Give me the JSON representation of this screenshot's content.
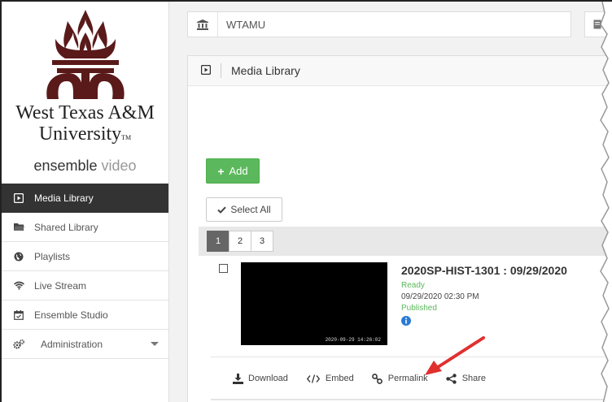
{
  "sidebar": {
    "university_line1": "West Texas A&M",
    "university_line2": "University",
    "tm": "TM",
    "product_bold": "ensemble",
    "product_light": "video",
    "items": [
      {
        "label": "Media Library",
        "icon": "media-icon",
        "active": true
      },
      {
        "label": "Shared Library",
        "icon": "folder-icon",
        "active": false
      },
      {
        "label": "Playlists",
        "icon": "globe-icon",
        "active": false
      },
      {
        "label": "Live Stream",
        "icon": "wifi-icon",
        "active": false
      },
      {
        "label": "Ensemble Studio",
        "icon": "calendar-icon",
        "active": false
      },
      {
        "label": "Administration",
        "icon": "gears-icon",
        "active": false
      }
    ]
  },
  "org": {
    "name": "WTAMU",
    "icon": "bank-icon"
  },
  "panel": {
    "title": "Media Library"
  },
  "toolbar": {
    "add_label": "Add",
    "select_all_label": "Select All"
  },
  "pagination": {
    "pages": [
      "1",
      "2",
      "3"
    ],
    "current": "1"
  },
  "media_item": {
    "title": "2020SP-HIST-1301 : 09/29/2020",
    "status": "Ready",
    "date": "09/29/2020 02:30 PM",
    "published": "Published",
    "thumb_timestamp": "2020-09-29  14:26:02"
  },
  "actions": [
    {
      "label": "Download",
      "icon": "download-icon"
    },
    {
      "label": "Embed",
      "icon": "code-icon"
    },
    {
      "label": "Permalink",
      "icon": "link-icon"
    },
    {
      "label": "Share",
      "icon": "share-icon"
    }
  ],
  "colors": {
    "brand_maroon": "#5a1a1a",
    "active_nav": "#333333",
    "success_green": "#5cb85c",
    "annotation_arrow": "#e03030",
    "info_blue": "#2a7bd4"
  }
}
